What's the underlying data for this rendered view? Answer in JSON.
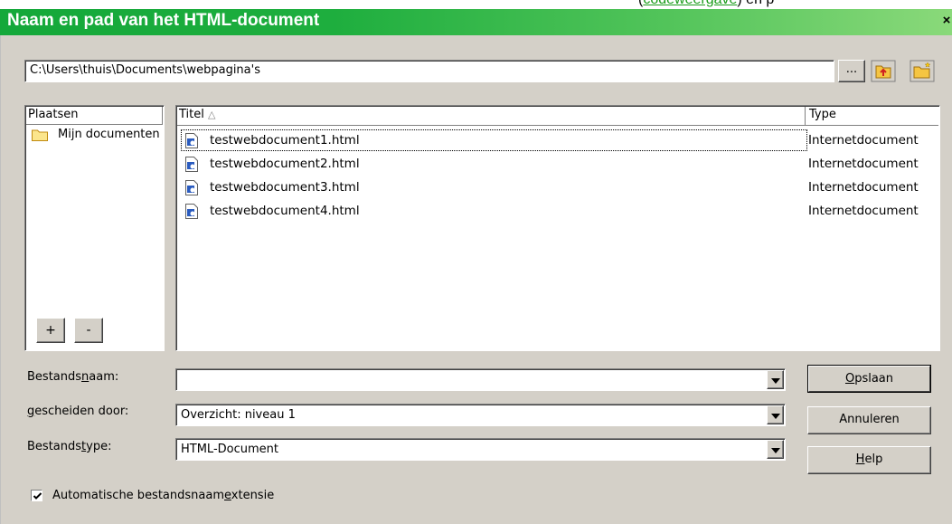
{
  "background": {
    "partial_text_before": "(",
    "partial_link": "codeweergave",
    "partial_text_after": ") en p"
  },
  "dialog": {
    "title": "Naam en pad van het HTML-document",
    "close_glyph": "×",
    "path": "C:\\Users\\thuis\\Documents\\webpagina's",
    "browse_label": "..."
  },
  "places": {
    "header": "Plaatsen",
    "items": [
      {
        "label": "Mijn documenten"
      }
    ],
    "add_label": "+",
    "remove_label": "-"
  },
  "files": {
    "col_title": "Titel",
    "sort_indicator": "△",
    "col_type": "Type",
    "rows": [
      {
        "name": "testwebdocument1.html",
        "type": "Internetdocument"
      },
      {
        "name": "testwebdocument2.html",
        "type": "Internetdocument"
      },
      {
        "name": "testwebdocument3.html",
        "type": "Internetdocument"
      },
      {
        "name": "testwebdocument4.html",
        "type": "Internetdocument"
      }
    ]
  },
  "form": {
    "filename": {
      "label_pre": "Bestands",
      "label_ul": "n",
      "label_post": "aam:",
      "value": ""
    },
    "separated": {
      "label_pre": "",
      "label_ul": "g",
      "label_post": "escheiden door:",
      "value": "Overzicht: niveau 1"
    },
    "filetype": {
      "label_pre": "Bestands",
      "label_ul": "t",
      "label_post": "ype:",
      "value": "HTML-Document"
    }
  },
  "buttons": {
    "save": {
      "ul": "O",
      "rest": "pslaan"
    },
    "cancel": "Annuleren",
    "help": {
      "ul": "H",
      "rest": "elp"
    }
  },
  "auto_extension": {
    "checked": true,
    "label_pre": "Automatische bestandsnaam",
    "label_ul": "e",
    "label_post": "xtensie"
  },
  "colors": {
    "title_gradient_start": "#14a83a",
    "title_gradient_end": "#8ad97a",
    "dialog_face": "#d4d0c8",
    "link_green": "#1a9c1a"
  }
}
